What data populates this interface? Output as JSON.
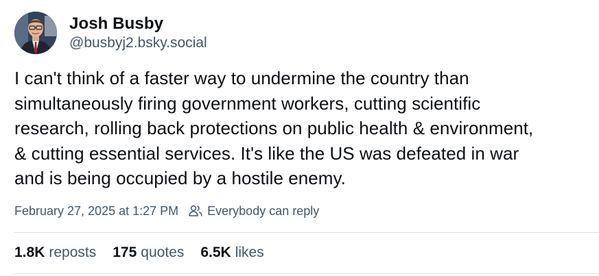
{
  "author": {
    "display_name": "Josh Busby",
    "handle": "@busbyj2.bsky.social",
    "avatar": "profile-photo"
  },
  "post": {
    "text": "I can't think of a faster way to undermine the country than\nsimultaneously firing government workers, cutting scientific\nresearch, rolling back protections on public health & environment,\n& cutting essential services. It's like the US was defeated in war\nand is being occupied by a hostile enemy."
  },
  "meta": {
    "timestamp": "February 27, 2025 at 1:27 PM",
    "reply_setting_icon": "people-icon",
    "reply_setting": "Everybody can reply"
  },
  "stats": {
    "reposts_count": "1.8K",
    "reposts_label": "reposts",
    "quotes_count": "175",
    "quotes_label": "quotes",
    "likes_count": "6.5K",
    "likes_label": "likes"
  },
  "colors": {
    "text": "#0b0f14",
    "secondary_text": "#42576c",
    "divider": "#d9e0e8",
    "background": "#ffffff"
  }
}
